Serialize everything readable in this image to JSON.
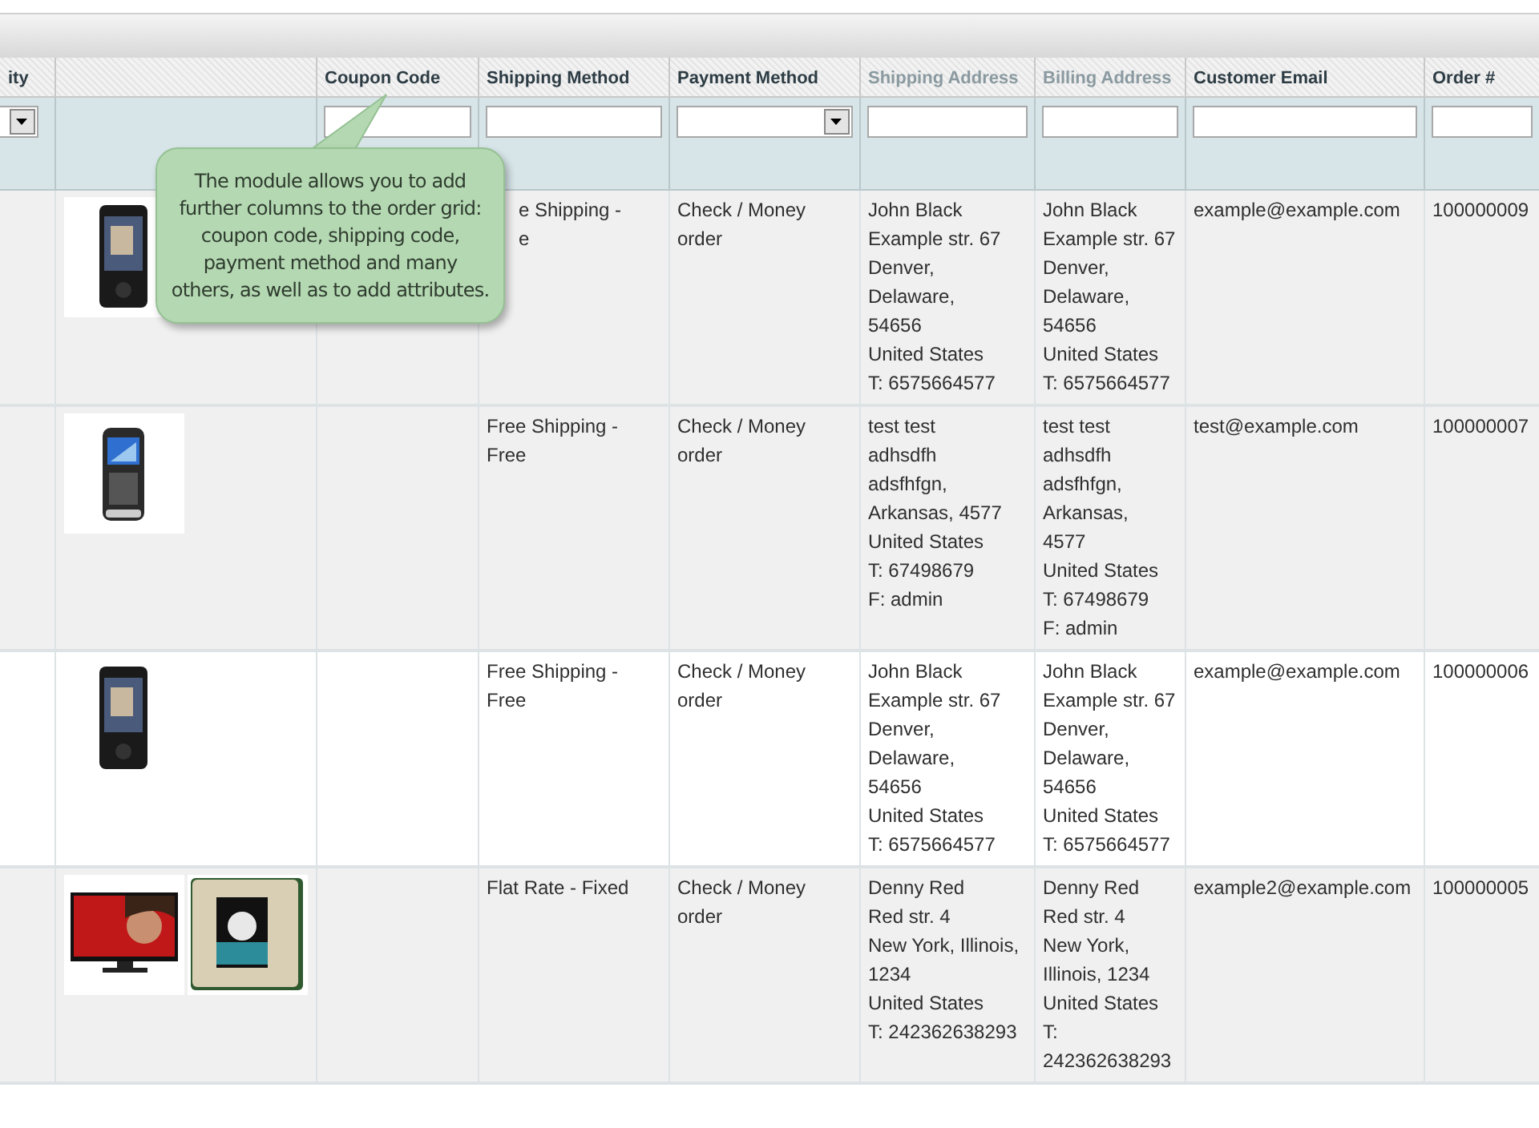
{
  "columns": [
    {
      "label": "ity",
      "muted": false,
      "filter": {
        "kind": "select"
      }
    },
    {},
    {
      "label": "Coupon Code",
      "muted": false,
      "filter": {
        "kind": "text"
      }
    },
    {
      "label": "Shipping Method",
      "muted": false,
      "filter": {
        "kind": "text"
      }
    },
    {
      "label": "Payment Method",
      "muted": false,
      "filter": {
        "kind": "select"
      }
    },
    {
      "label": "Shipping Address",
      "muted": true,
      "filter": {
        "kind": "text"
      }
    },
    {
      "label": "Billing Address",
      "muted": true,
      "filter": {
        "kind": "text"
      }
    },
    {
      "label": "Customer Email",
      "muted": false,
      "filter": {
        "kind": "text"
      }
    },
    {
      "label": "Order #",
      "muted": false,
      "filter": {
        "kind": "text"
      }
    }
  ],
  "rows": [
    {
      "hovered": false,
      "images": [
        {
          "kind": "picture"
        }
      ],
      "shipping_method": {
        "lines": [
          "e Shipping -",
          "e"
        ],
        "partly_hidden": true
      },
      "payment_method": [
        "Check / Money",
        "order"
      ],
      "shipping_address": [
        "John Black",
        "Example str. 67",
        "Denver, Delaware,",
        "54656",
        "United States",
        "T: 6575664577"
      ],
      "billing_address": [
        "John Black",
        "Example str. 67",
        "Denver,",
        "Delaware,",
        "54656",
        "United States",
        "T: 6575664577"
      ],
      "customer_email": "example@example.com",
      "order_number": "100000009"
    },
    {
      "hovered": false,
      "images": [
        {
          "kind": "picture"
        }
      ],
      "shipping_method": {
        "lines": [
          "Free Shipping -",
          "Free"
        ],
        "partly_hidden": false
      },
      "payment_method": [
        "Check / Money",
        "order"
      ],
      "shipping_address": [
        "test test",
        "adhsdfh",
        "adsfhfgn,",
        "Arkansas, 4577",
        "United States",
        "T: 67498679",
        "F: admin"
      ],
      "billing_address": [
        "test test",
        "adhsdfh",
        "adsfhfgn,",
        "Arkansas,",
        "4577",
        "United States",
        "T: 67498679",
        "F: admin"
      ],
      "customer_email": "test@example.com",
      "order_number": "100000007"
    },
    {
      "hovered": true,
      "images": [
        {
          "kind": "picture"
        }
      ],
      "shipping_method": {
        "lines": [
          "Free Shipping -",
          "Free"
        ],
        "partly_hidden": false
      },
      "payment_method": [
        "Check / Money",
        "order"
      ],
      "shipping_address": [
        "John Black",
        "Example str. 67",
        "Denver, Delaware,",
        "54656",
        "United States",
        "T: 6575664577"
      ],
      "billing_address": [
        "John Black",
        "Example str. 67",
        "Denver,",
        "Delaware,",
        "54656",
        "United States",
        "T: 6575664577"
      ],
      "customer_email": "example@example.com",
      "order_number": "100000006"
    },
    {
      "hovered": false,
      "images": [
        {
          "kind": "picture"
        },
        {
          "kind": "picture"
        }
      ],
      "shipping_method": {
        "lines": [
          "Flat Rate - Fixed"
        ],
        "partly_hidden": false
      },
      "payment_method": [
        "Check / Money",
        "order"
      ],
      "shipping_address": [
        "Denny Red",
        "Red str. 4",
        "New York, Illinois,",
        "1234",
        "United States",
        "T: 242362638293"
      ],
      "billing_address": [
        "Denny Red",
        "Red str. 4",
        "New York,",
        "Illinois, 1234",
        "United States",
        "T:",
        "242362638293"
      ],
      "customer_email": "example2@example.com",
      "order_number": "100000005"
    }
  ],
  "callout": {
    "text": "The module allows you to add further columns to the order grid: coupon code, shipping code, payment method and many others, as well as to add attributes."
  }
}
